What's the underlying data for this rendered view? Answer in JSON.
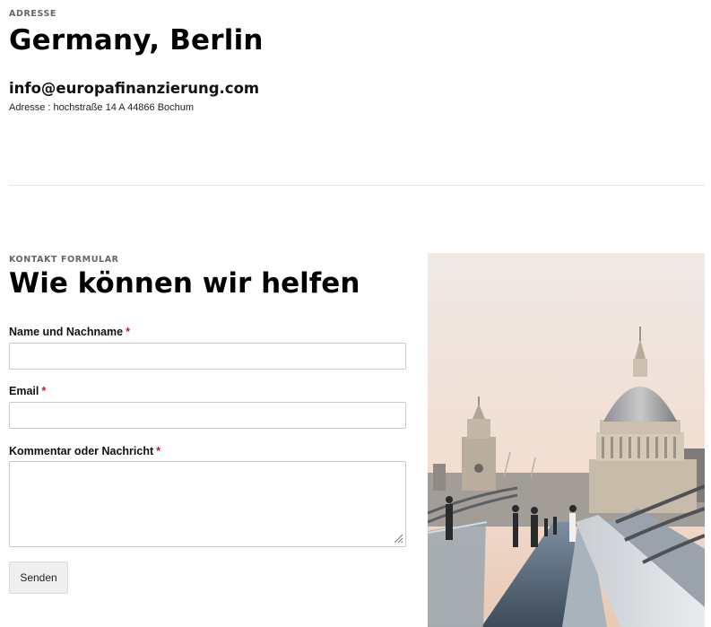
{
  "address_section": {
    "eyebrow": "ADRESSE",
    "city": "Germany, Berlin",
    "email": "info@europafinanzierung.com",
    "address": "Adresse : hochstraße 14 A 44866 Bochum"
  },
  "contact_section": {
    "eyebrow": "KONTAKT FORMULAR",
    "heading": "Wie können wir helfen",
    "fields": [
      {
        "label": "Name und Nachname",
        "required_mark": "*",
        "value": "",
        "placeholder": ""
      },
      {
        "label": "Email",
        "required_mark": "*",
        "value": "",
        "placeholder": ""
      },
      {
        "label": "Kommentar oder Nachricht",
        "required_mark": "*",
        "value": "",
        "placeholder": ""
      }
    ],
    "submit_label": "Senden"
  },
  "image": {
    "subject": "city-cathedral-bridge-photo"
  },
  "colors": {
    "required": "#d0102a",
    "heading": "#000000",
    "eyebrow": "#666666",
    "input_border": "#c9c9c9",
    "button_bg": "#efefef"
  }
}
